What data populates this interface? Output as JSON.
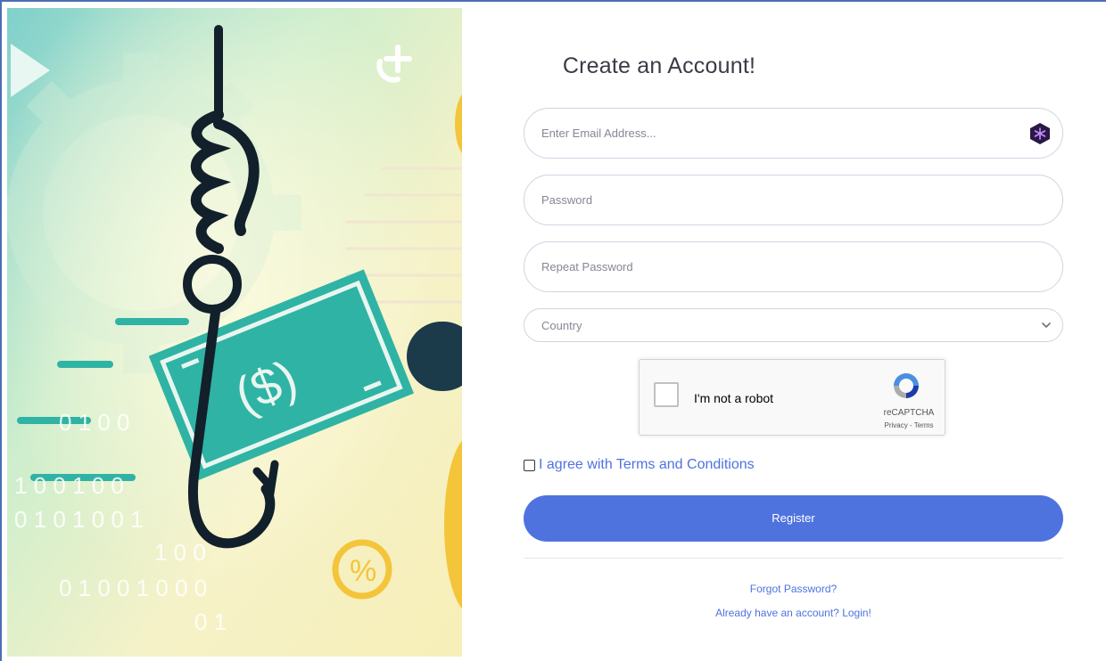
{
  "form": {
    "title": "Create an Account!",
    "email_placeholder": "Enter Email Address...",
    "password_placeholder": "Password",
    "repeat_password_placeholder": "Repeat Password",
    "country_selected": "Country",
    "extension_icon": "extension-icon",
    "chevron_icon": "chevron-down-icon"
  },
  "captcha": {
    "label": "I'm not a robot",
    "brand": "reCAPTCHA",
    "links": "Privacy - Terms",
    "logo_icon": "recaptcha-logo-icon"
  },
  "agree": {
    "label": "I agree with Terms and Conditions",
    "checked": false
  },
  "register": {
    "label": "Register",
    "color": "#4e73df"
  },
  "links": {
    "forgot": "Forgot Password?",
    "login": "Already have an account? Login!"
  },
  "illustration": {
    "icon": "phishing-hook-icon",
    "binary_digits": [
      "0 1 0 0",
      "1 0 0 1 0 0",
      "0 1 0 1 0 0 1",
      "1 0 0",
      "0 1 0 0 1 0 0 0",
      "0 1"
    ],
    "currency_symbol": "($)",
    "colors": {
      "teal": "#2fb3a4",
      "navy": "#1b2b3a",
      "yellow": "#f4c53a"
    }
  }
}
